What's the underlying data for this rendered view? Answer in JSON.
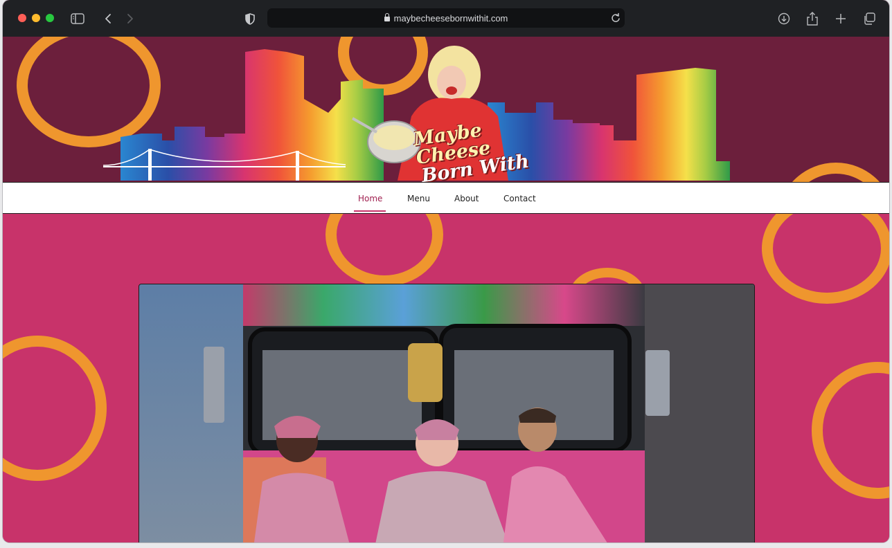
{
  "browser": {
    "url": "maybecheesebornwithit.com",
    "traffic_lights": {
      "close": "#fe5f57",
      "minimize": "#febc2e",
      "zoom": "#28c840"
    },
    "icons": [
      "sidebar-icon",
      "back-icon",
      "forward-icon",
      "shield-icon",
      "lock-icon",
      "reload-icon",
      "download-icon",
      "share-icon",
      "new-tab-icon",
      "tabs-overview-icon"
    ]
  },
  "header": {
    "logo_line1": "Maybe Cheese",
    "logo_line2": "Born With it!",
    "background": "#6c1f3c",
    "accent_ring": "#ef962e"
  },
  "nav": {
    "items": [
      {
        "label": "Home",
        "active": true
      },
      {
        "label": "Menu",
        "active": false
      },
      {
        "label": "About",
        "active": false
      },
      {
        "label": "Contact",
        "active": false
      }
    ]
  },
  "main": {
    "background": "#c8336a",
    "photo_alt": "hero photo of food truck with three people"
  }
}
